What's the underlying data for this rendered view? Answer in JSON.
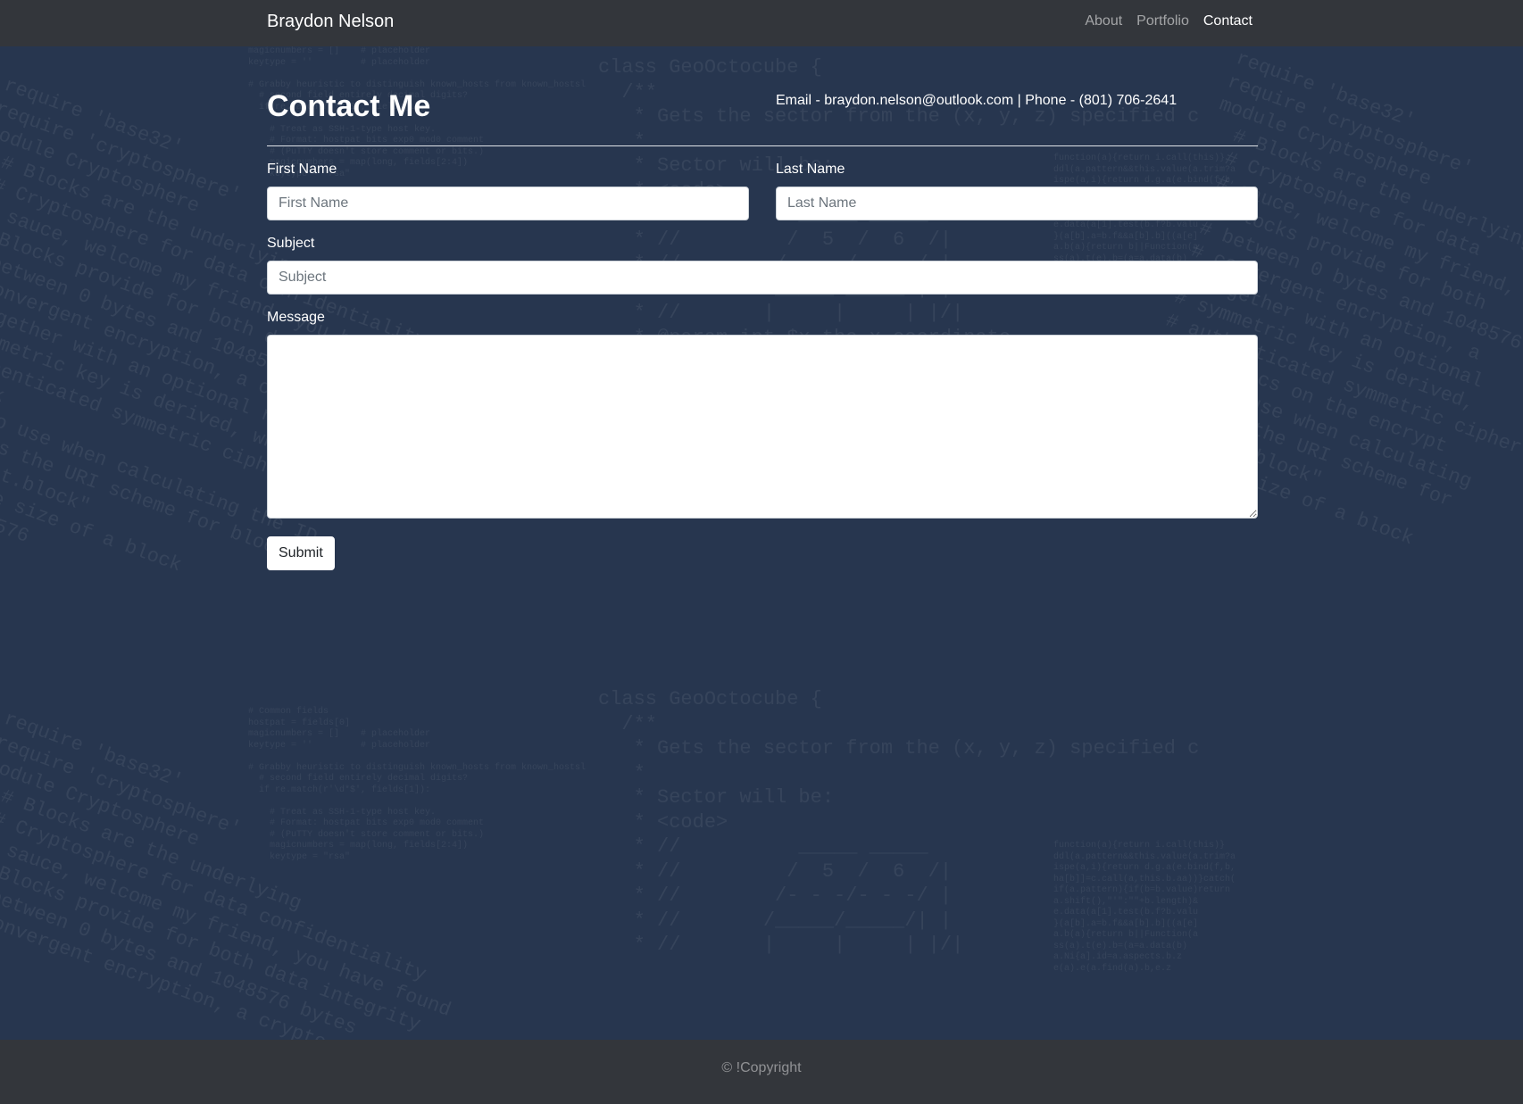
{
  "navbar": {
    "brand": "Braydon Nelson",
    "links": [
      {
        "label": "About"
      },
      {
        "label": "Portfolio"
      },
      {
        "label": "Contact"
      }
    ]
  },
  "page": {
    "title": "Contact Me",
    "contact_info": "Email - braydon.nelson@outlook.com | Phone - (801) 706-2641"
  },
  "form": {
    "first_name": {
      "label": "First Name",
      "placeholder": "First Name",
      "value": ""
    },
    "last_name": {
      "label": "Last Name",
      "placeholder": "Last Name",
      "value": ""
    },
    "subject": {
      "label": "Subject",
      "placeholder": "Subject",
      "value": ""
    },
    "message": {
      "label": "Message",
      "value": ""
    },
    "submit_label": "Submit"
  },
  "footer": {
    "text": "© !Copyright"
  },
  "colors": {
    "background": "#27364f",
    "navbar": "#33363b",
    "footer": "#33363b"
  }
}
